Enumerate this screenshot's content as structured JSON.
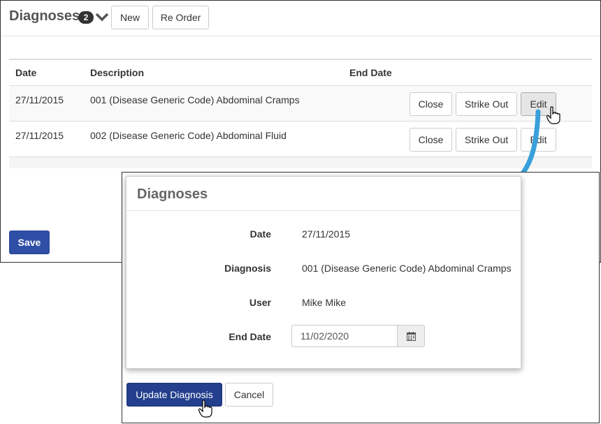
{
  "background": {
    "title": "Diagnoses",
    "count": "2",
    "new_label": "New",
    "reorder_label": "Re Order",
    "columns": [
      "Date",
      "Description",
      "End Date"
    ],
    "rows": [
      {
        "date": "27/11/2015",
        "description": "001 (Disease Generic Code) Abdominal Cramps",
        "close": "Close",
        "strike": "Strike Out",
        "edit": "Edit"
      },
      {
        "date": "27/11/2015",
        "description": "002 (Disease Generic Code) Abdominal Fluid",
        "close": "Close",
        "strike": "Strike Out",
        "edit": "Edit"
      }
    ],
    "save_label": "Save"
  },
  "modal": {
    "title": "Diagnoses",
    "fields": {
      "date_label": "Date",
      "date_value": "27/11/2015",
      "diagnosis_label": "Diagnosis",
      "diagnosis_value": "001 (Disease Generic Code) Abdominal Cramps",
      "user_label": "User",
      "user_value": "Mike Mike",
      "end_date_label": "End Date",
      "end_date_value": "11/02/2020"
    },
    "update_label": "Update Diagnosis",
    "cancel_label": "Cancel"
  },
  "icons": {
    "calendar": "calendar-icon",
    "chevron": "chevron-down-icon",
    "cursor": "hand-pointer-icon"
  },
  "colors": {
    "primary": "#2e4fa5",
    "primary_dark": "#233f8d",
    "arrow": "#3aa0dc"
  }
}
